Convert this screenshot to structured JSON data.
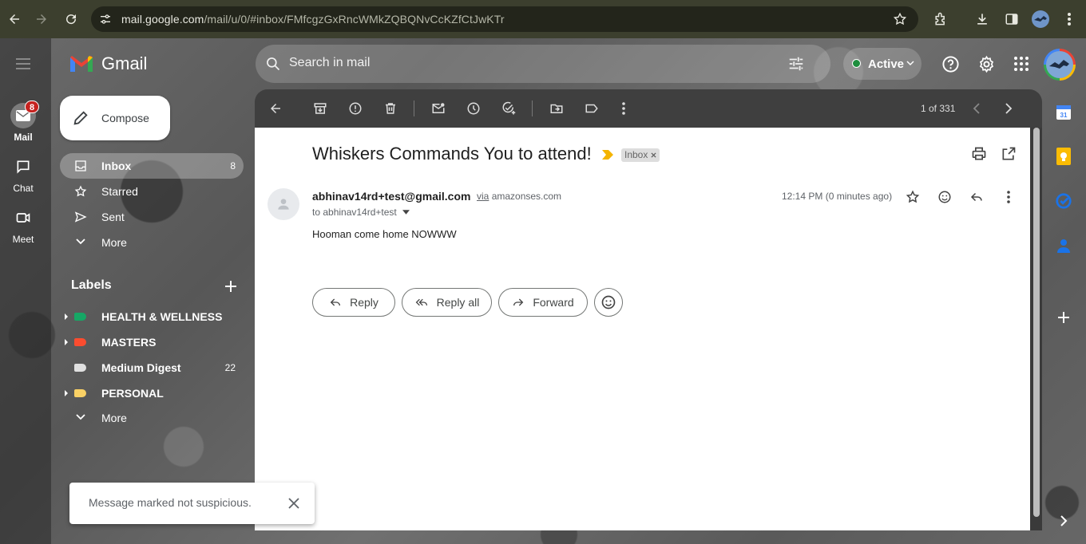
{
  "browser": {
    "url_host": "mail.google.com",
    "url_path": "/mail/u/0/#inbox/FMfcgzGxRncWMkZQBQNvCcKZfCtJwKTr"
  },
  "app": {
    "name": "Gmail",
    "search_placeholder": "Search in mail",
    "status": "Active"
  },
  "rail": {
    "mail_label": "Mail",
    "mail_badge": "8",
    "chat_label": "Chat",
    "meet_label": "Meet"
  },
  "sidebar": {
    "compose_label": "Compose",
    "items": [
      {
        "label": "Inbox",
        "count": "8"
      },
      {
        "label": "Starred",
        "count": ""
      },
      {
        "label": "Sent",
        "count": ""
      },
      {
        "label": "More",
        "count": ""
      }
    ],
    "labels_heading": "Labels",
    "labels": [
      {
        "label": "HEALTH & WELLNESS",
        "color": "#16a765",
        "count": ""
      },
      {
        "label": "MASTERS",
        "color": "#fb4c2f",
        "count": ""
      },
      {
        "label": "Medium Digest",
        "color": "#e0e0e0",
        "count": "22"
      },
      {
        "label": "PERSONAL",
        "color": "#fad165",
        "count": ""
      }
    ],
    "labels_more": "More"
  },
  "toolbar": {
    "pager": "1 of 331"
  },
  "message": {
    "subject": "Whiskers Commands You to attend!",
    "inbox_chip": "Inbox",
    "sender_email": "abhinav14rd+test@gmail.com",
    "via_word": "via",
    "via_domain": "amazonses.com",
    "to_line": "to abhinav14rd+test",
    "time": "12:14 PM (0 minutes ago)",
    "body": "Hooman come home NOWWW",
    "reply_label": "Reply",
    "reply_all_label": "Reply all",
    "forward_label": "Forward"
  },
  "side_panel": {
    "calendar_date": "31"
  },
  "toast": {
    "text": "Message marked not suspicious."
  },
  "colors": {
    "accent_red": "#c5221f",
    "status_green": "#1e8e3e",
    "important_yellow": "#f4b400"
  }
}
